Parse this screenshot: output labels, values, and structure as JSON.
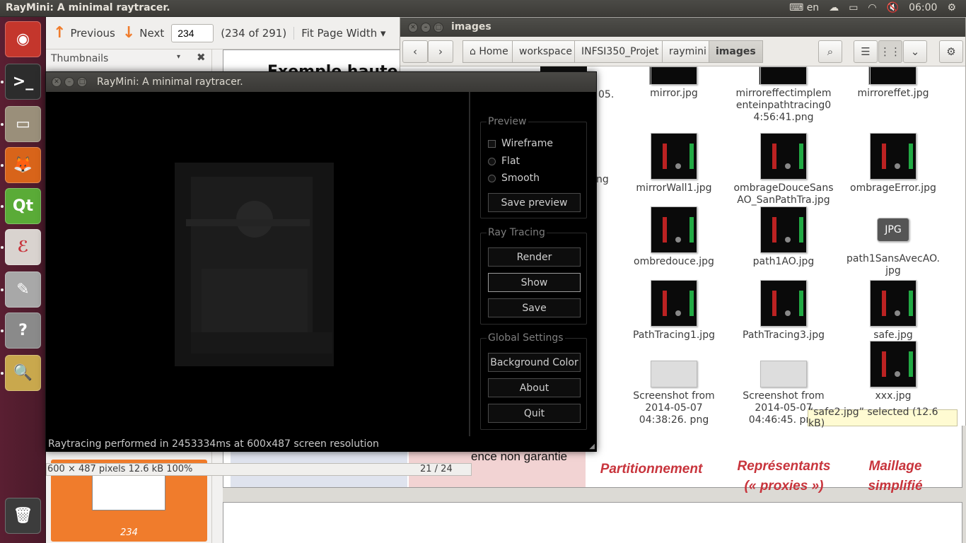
{
  "top_panel": {
    "title": "RayMini: A minimal raytracer.",
    "keyboard": "en",
    "time": "06:00"
  },
  "launcher": {
    "items": [
      {
        "name": "ubuntu-dash",
        "glyph": "◉",
        "bg": "#c4362c"
      },
      {
        "name": "terminal",
        "glyph": ">_",
        "bg": "#2c2c2c"
      },
      {
        "name": "file-manager",
        "glyph": "▭",
        "bg": "#9a8f7a"
      },
      {
        "name": "firefox",
        "glyph": "🦊",
        "bg": "#d8641a"
      },
      {
        "name": "qt-creator",
        "glyph": "Qt",
        "bg": "#5aab37"
      },
      {
        "name": "document-viewer",
        "glyph": "ℰ",
        "bg": "#d9d3cf"
      },
      {
        "name": "text-editor",
        "glyph": "✎",
        "bg": "#a8a8a8"
      },
      {
        "name": "help",
        "glyph": "?",
        "bg": "#8a8a8a"
      },
      {
        "name": "image-viewer",
        "glyph": "🔍",
        "bg": "#c9a84d"
      },
      {
        "name": "trash",
        "glyph": "🗑",
        "bg": "#3c3c3c"
      }
    ]
  },
  "evince": {
    "prev_label": "Previous",
    "next_label": "Next",
    "page_value": "234",
    "page_count": "(234 of 291)",
    "zoom": "Fit Page Width",
    "sidebar_title": "Thumbnails",
    "thumb_page": "234",
    "heading_partial": "Exemple haute",
    "ref_text": "ence non garantie",
    "labels": [
      "Partitionnement",
      "Représentants\n(« proxies »)",
      "Maillage\nsimplifié"
    ]
  },
  "eog": {
    "info": "600 × 487 pixels  12.6 kB    100%",
    "index": "21 / 24"
  },
  "nautilus": {
    "title": "images",
    "crumbs": [
      "Home",
      "workspace",
      "INFSI350_Projet",
      "raymini",
      "images"
    ],
    "partial_left": [
      "05.",
      "ng"
    ],
    "files": [
      {
        "name": "mirror.jpg",
        "col": 0,
        "row": 0
      },
      {
        "name": "mirroreffectimplem enteinpathtracing0 4:56:41.png",
        "col": 1,
        "row": 0
      },
      {
        "name": "mirroreffet.jpg",
        "col": 2,
        "row": 0
      },
      {
        "name": "mirrorWall1.jpg",
        "col": 0,
        "row": 1
      },
      {
        "name": "ombrageDouceSans AO_SanPathTra.jpg",
        "col": 1,
        "row": 1
      },
      {
        "name": "ombrageError.jpg",
        "col": 2,
        "row": 1
      },
      {
        "name": "ombredouce.jpg",
        "col": 0,
        "row": 2
      },
      {
        "name": "path1AO.jpg",
        "col": 1,
        "row": 2
      },
      {
        "name": "path1SansAvecAO. jpg",
        "col": 2,
        "row": 2,
        "generic": "JPG"
      },
      {
        "name": "PathTracing1.jpg",
        "col": 0,
        "row": 3
      },
      {
        "name": "PathTracing3.jpg",
        "col": 1,
        "row": 3
      },
      {
        "name": "safe.jpg",
        "col": 2,
        "row": 3
      },
      {
        "name": "Screenshot from 2014-05-07 04:38:26. png",
        "col": 0,
        "row": 4,
        "shot": true
      },
      {
        "name": "Screenshot from 2014-05-07 04:46:45. png",
        "col": 1,
        "row": 4,
        "shot": true
      },
      {
        "name": "xxx.jpg",
        "col": 2,
        "row": 4
      }
    ],
    "status": "“safe2.jpg” selected  (12.6 kB)"
  },
  "raymini": {
    "title": "RayMini: A minimal raytracer.",
    "preview_group": "Preview",
    "wireframe": "Wireframe",
    "flat": "Flat",
    "smooth": "Smooth",
    "save_preview": "Save preview",
    "ray_group": "Ray Tracing",
    "render": "Render",
    "show": "Show",
    "save": "Save",
    "global_group": "Global Settings",
    "bg_color": "Background Color",
    "about": "About",
    "quit": "Quit",
    "status": "Raytracing performed in 2453334ms at 600x487 screen resolution"
  }
}
